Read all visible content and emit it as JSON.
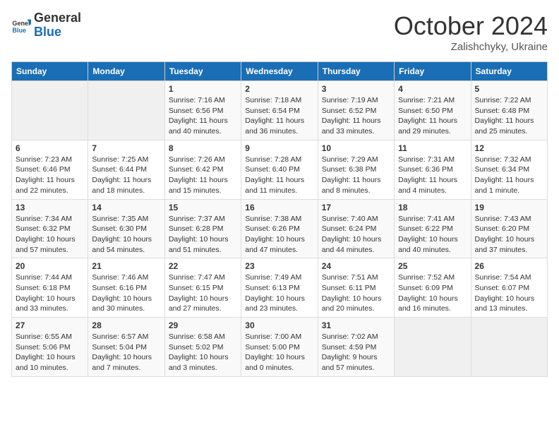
{
  "header": {
    "logo_line1": "General",
    "logo_line2": "Blue",
    "month": "October 2024",
    "location": "Zalishchyky, Ukraine"
  },
  "days_of_week": [
    "Sunday",
    "Monday",
    "Tuesday",
    "Wednesday",
    "Thursday",
    "Friday",
    "Saturday"
  ],
  "weeks": [
    [
      null,
      null,
      {
        "day": "1",
        "sunrise": "Sunrise: 7:16 AM",
        "sunset": "Sunset: 6:56 PM",
        "daylight": "Daylight: 11 hours and 40 minutes."
      },
      {
        "day": "2",
        "sunrise": "Sunrise: 7:18 AM",
        "sunset": "Sunset: 6:54 PM",
        "daylight": "Daylight: 11 hours and 36 minutes."
      },
      {
        "day": "3",
        "sunrise": "Sunrise: 7:19 AM",
        "sunset": "Sunset: 6:52 PM",
        "daylight": "Daylight: 11 hours and 33 minutes."
      },
      {
        "day": "4",
        "sunrise": "Sunrise: 7:21 AM",
        "sunset": "Sunset: 6:50 PM",
        "daylight": "Daylight: 11 hours and 29 minutes."
      },
      {
        "day": "5",
        "sunrise": "Sunrise: 7:22 AM",
        "sunset": "Sunset: 6:48 PM",
        "daylight": "Daylight: 11 hours and 25 minutes."
      }
    ],
    [
      {
        "day": "6",
        "sunrise": "Sunrise: 7:23 AM",
        "sunset": "Sunset: 6:46 PM",
        "daylight": "Daylight: 11 hours and 22 minutes."
      },
      {
        "day": "7",
        "sunrise": "Sunrise: 7:25 AM",
        "sunset": "Sunset: 6:44 PM",
        "daylight": "Daylight: 11 hours and 18 minutes."
      },
      {
        "day": "8",
        "sunrise": "Sunrise: 7:26 AM",
        "sunset": "Sunset: 6:42 PM",
        "daylight": "Daylight: 11 hours and 15 minutes."
      },
      {
        "day": "9",
        "sunrise": "Sunrise: 7:28 AM",
        "sunset": "Sunset: 6:40 PM",
        "daylight": "Daylight: 11 hours and 11 minutes."
      },
      {
        "day": "10",
        "sunrise": "Sunrise: 7:29 AM",
        "sunset": "Sunset: 6:38 PM",
        "daylight": "Daylight: 11 hours and 8 minutes."
      },
      {
        "day": "11",
        "sunrise": "Sunrise: 7:31 AM",
        "sunset": "Sunset: 6:36 PM",
        "daylight": "Daylight: 11 hours and 4 minutes."
      },
      {
        "day": "12",
        "sunrise": "Sunrise: 7:32 AM",
        "sunset": "Sunset: 6:34 PM",
        "daylight": "Daylight: 11 hours and 1 minute."
      }
    ],
    [
      {
        "day": "13",
        "sunrise": "Sunrise: 7:34 AM",
        "sunset": "Sunset: 6:32 PM",
        "daylight": "Daylight: 10 hours and 57 minutes."
      },
      {
        "day": "14",
        "sunrise": "Sunrise: 7:35 AM",
        "sunset": "Sunset: 6:30 PM",
        "daylight": "Daylight: 10 hours and 54 minutes."
      },
      {
        "day": "15",
        "sunrise": "Sunrise: 7:37 AM",
        "sunset": "Sunset: 6:28 PM",
        "daylight": "Daylight: 10 hours and 51 minutes."
      },
      {
        "day": "16",
        "sunrise": "Sunrise: 7:38 AM",
        "sunset": "Sunset: 6:26 PM",
        "daylight": "Daylight: 10 hours and 47 minutes."
      },
      {
        "day": "17",
        "sunrise": "Sunrise: 7:40 AM",
        "sunset": "Sunset: 6:24 PM",
        "daylight": "Daylight: 10 hours and 44 minutes."
      },
      {
        "day": "18",
        "sunrise": "Sunrise: 7:41 AM",
        "sunset": "Sunset: 6:22 PM",
        "daylight": "Daylight: 10 hours and 40 minutes."
      },
      {
        "day": "19",
        "sunrise": "Sunrise: 7:43 AM",
        "sunset": "Sunset: 6:20 PM",
        "daylight": "Daylight: 10 hours and 37 minutes."
      }
    ],
    [
      {
        "day": "20",
        "sunrise": "Sunrise: 7:44 AM",
        "sunset": "Sunset: 6:18 PM",
        "daylight": "Daylight: 10 hours and 33 minutes."
      },
      {
        "day": "21",
        "sunrise": "Sunrise: 7:46 AM",
        "sunset": "Sunset: 6:16 PM",
        "daylight": "Daylight: 10 hours and 30 minutes."
      },
      {
        "day": "22",
        "sunrise": "Sunrise: 7:47 AM",
        "sunset": "Sunset: 6:15 PM",
        "daylight": "Daylight: 10 hours and 27 minutes."
      },
      {
        "day": "23",
        "sunrise": "Sunrise: 7:49 AM",
        "sunset": "Sunset: 6:13 PM",
        "daylight": "Daylight: 10 hours and 23 minutes."
      },
      {
        "day": "24",
        "sunrise": "Sunrise: 7:51 AM",
        "sunset": "Sunset: 6:11 PM",
        "daylight": "Daylight: 10 hours and 20 minutes."
      },
      {
        "day": "25",
        "sunrise": "Sunrise: 7:52 AM",
        "sunset": "Sunset: 6:09 PM",
        "daylight": "Daylight: 10 hours and 16 minutes."
      },
      {
        "day": "26",
        "sunrise": "Sunrise: 7:54 AM",
        "sunset": "Sunset: 6:07 PM",
        "daylight": "Daylight: 10 hours and 13 minutes."
      }
    ],
    [
      {
        "day": "27",
        "sunrise": "Sunrise: 6:55 AM",
        "sunset": "Sunset: 5:06 PM",
        "daylight": "Daylight: 10 hours and 10 minutes."
      },
      {
        "day": "28",
        "sunrise": "Sunrise: 6:57 AM",
        "sunset": "Sunset: 5:04 PM",
        "daylight": "Daylight: 10 hours and 7 minutes."
      },
      {
        "day": "29",
        "sunrise": "Sunrise: 6:58 AM",
        "sunset": "Sunset: 5:02 PM",
        "daylight": "Daylight: 10 hours and 3 minutes."
      },
      {
        "day": "30",
        "sunrise": "Sunrise: 7:00 AM",
        "sunset": "Sunset: 5:00 PM",
        "daylight": "Daylight: 10 hours and 0 minutes."
      },
      {
        "day": "31",
        "sunrise": "Sunrise: 7:02 AM",
        "sunset": "Sunset: 4:59 PM",
        "daylight": "Daylight: 9 hours and 57 minutes."
      },
      null,
      null
    ]
  ]
}
